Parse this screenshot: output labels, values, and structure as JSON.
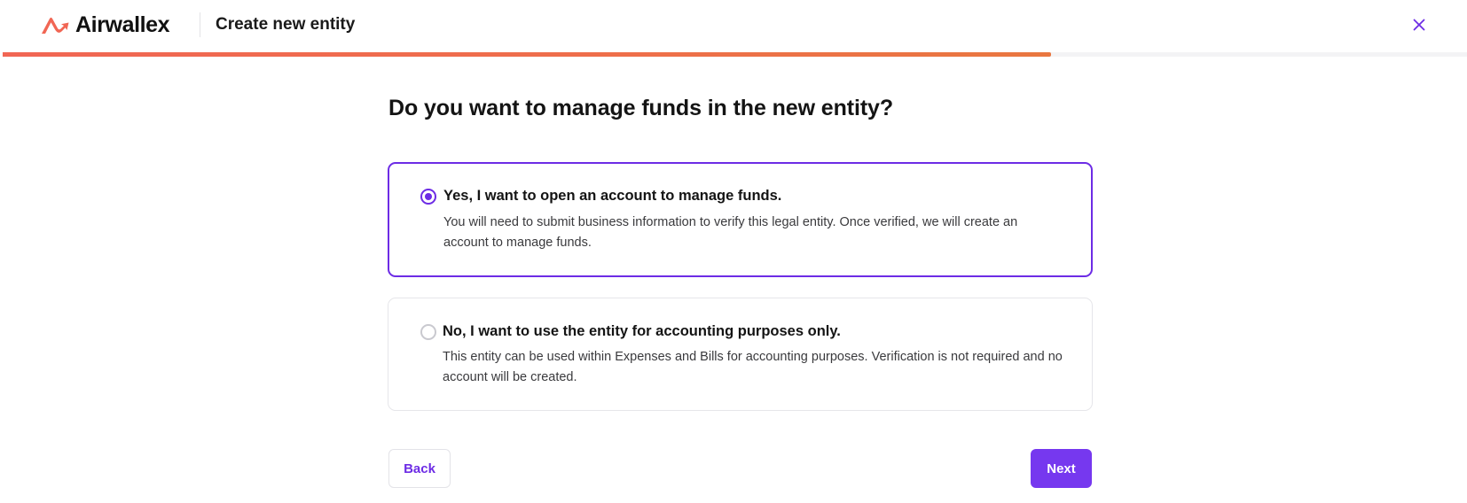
{
  "header": {
    "brand_name": "Airwallex",
    "brand_color": "#f16654",
    "page_title": "Create new entity",
    "close_icon": "close-icon"
  },
  "progress": {
    "fraction": 0.716,
    "fill_color": "#f16654"
  },
  "question": "Do you want to manage funds in the new entity?",
  "options": [
    {
      "title": "Yes, I want to open an account to manage funds.",
      "description": "You will need to submit business information to verify this legal entity. Once verified, we will create an account to manage funds.",
      "selected": true
    },
    {
      "title": "No, I want to use the entity for accounting purposes only.",
      "description": "This entity can be used within Expenses and Bills for accounting purposes. Verification is not required and no account will be created.",
      "selected": false
    }
  ],
  "actions": {
    "back_label": "Back",
    "next_label": "Next"
  },
  "colors": {
    "accent": "#6d2ce5",
    "primary_button": "#7638ef"
  }
}
